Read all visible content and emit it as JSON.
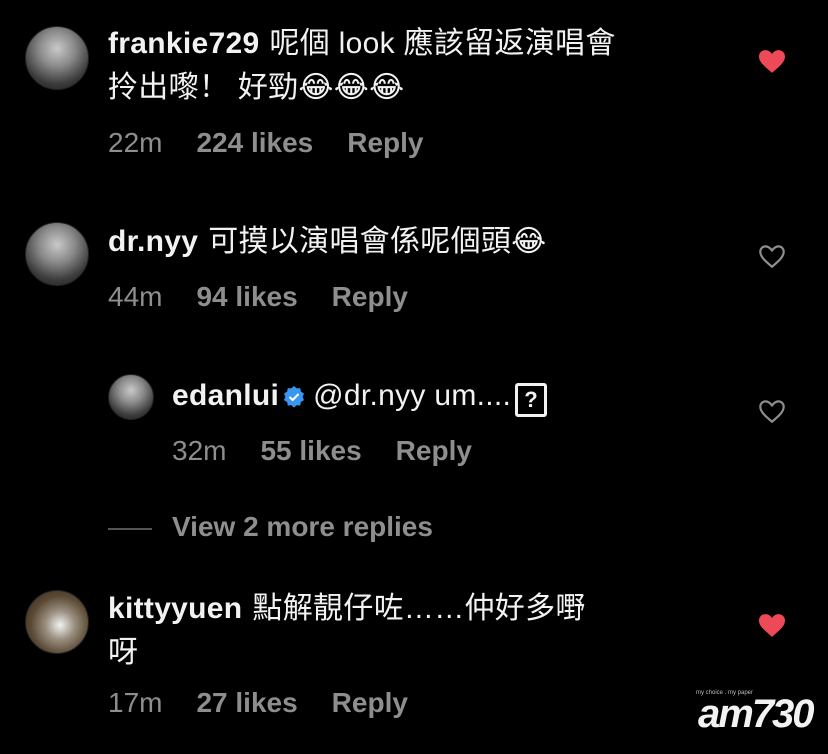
{
  "comments": [
    {
      "username": "frankie729",
      "text": "呢個 look 應該留返演唱會",
      "text_line2": "拎出嚟！ 好勁😂😂😂",
      "time": "22m",
      "likes": "224 likes",
      "reply": "Reply",
      "liked": true
    },
    {
      "username": "dr.nyy",
      "text": "可摸以演唱會係呢個頭😂",
      "time": "44m",
      "likes": "94 likes",
      "reply": "Reply",
      "liked": false
    },
    {
      "username": "edanlui",
      "text": "@dr.nyy um....",
      "unknown_glyph": "?",
      "time": "32m",
      "likes": "55 likes",
      "reply": "Reply",
      "liked": false,
      "verified": true
    },
    {
      "username": "kittyyuen",
      "text": "點解靚仔咗……仲好多嘢",
      "text_line2": "呀",
      "time": "17m",
      "likes": "27 likes",
      "reply": "Reply",
      "liked": true
    }
  ],
  "view_more": "View 2 more replies",
  "watermark": {
    "main": "am730",
    "tagline": "my choice . my paper"
  },
  "colors": {
    "background": "#000000",
    "text": "#f2f2f2",
    "meta": "#8e8e8e",
    "heart_liked": "#ed4956",
    "verified": "#3897f0"
  },
  "icons": {
    "heart_filled": "heart-filled-icon",
    "heart_outline": "heart-outline-icon",
    "verified": "verified-badge-icon"
  }
}
